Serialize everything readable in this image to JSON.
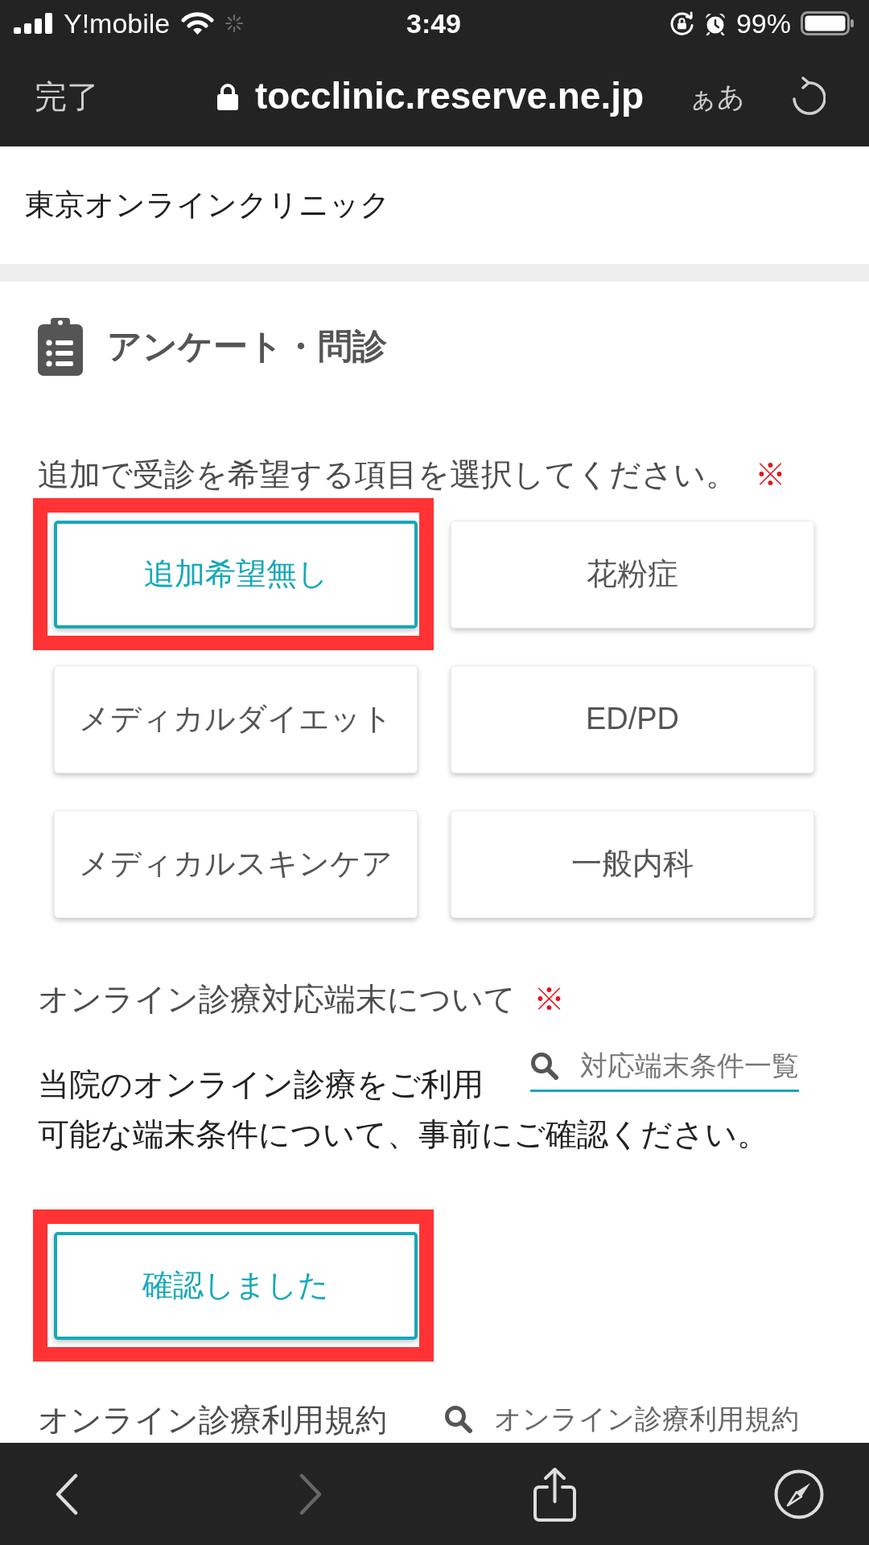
{
  "status_bar": {
    "carrier": "Y!mobile",
    "time": "3:49",
    "battery": "99%"
  },
  "browser_bar": {
    "done": "完了",
    "url": "tocclinic.reserve.ne.jp",
    "text_size": "ぁあ"
  },
  "header": {
    "title": "東京オンラインクリニック"
  },
  "section": {
    "title": "アンケート・問診"
  },
  "questions": [
    {
      "kind": "choices",
      "label": "追加で受診を希望する項目を選択してください。",
      "required_mark": "※",
      "options": [
        {
          "label": "追加希望無し",
          "selected": true,
          "highlighted": true
        },
        {
          "label": "花粉症",
          "selected": false,
          "highlighted": false
        },
        {
          "label": "メディカルダイエット",
          "selected": false,
          "highlighted": false
        },
        {
          "label": "ED/PD",
          "selected": false,
          "highlighted": false
        },
        {
          "label": "メディカルスキンケア",
          "selected": false,
          "highlighted": false
        },
        {
          "label": "一般内科",
          "selected": false,
          "highlighted": false
        }
      ]
    },
    {
      "kind": "confirm",
      "label": "オンライン診療対応端末について",
      "required_mark": "※",
      "text": "当院のオンライン診療をご利用可能な端末条件について、事前にご確認ください。",
      "link": "対応端末条件一覧",
      "options": [
        {
          "label": "確認しました",
          "selected": true,
          "highlighted": true
        }
      ]
    },
    {
      "kind": "terms",
      "label": "オンライン診療利用規約",
      "link": "オンライン診療利用規約"
    }
  ],
  "toolbar": [
    {
      "kind": "back",
      "disabled": false
    },
    {
      "kind": "forward",
      "disabled": true
    },
    {
      "kind": "share",
      "disabled": false
    },
    {
      "kind": "compass",
      "disabled": false
    }
  ]
}
